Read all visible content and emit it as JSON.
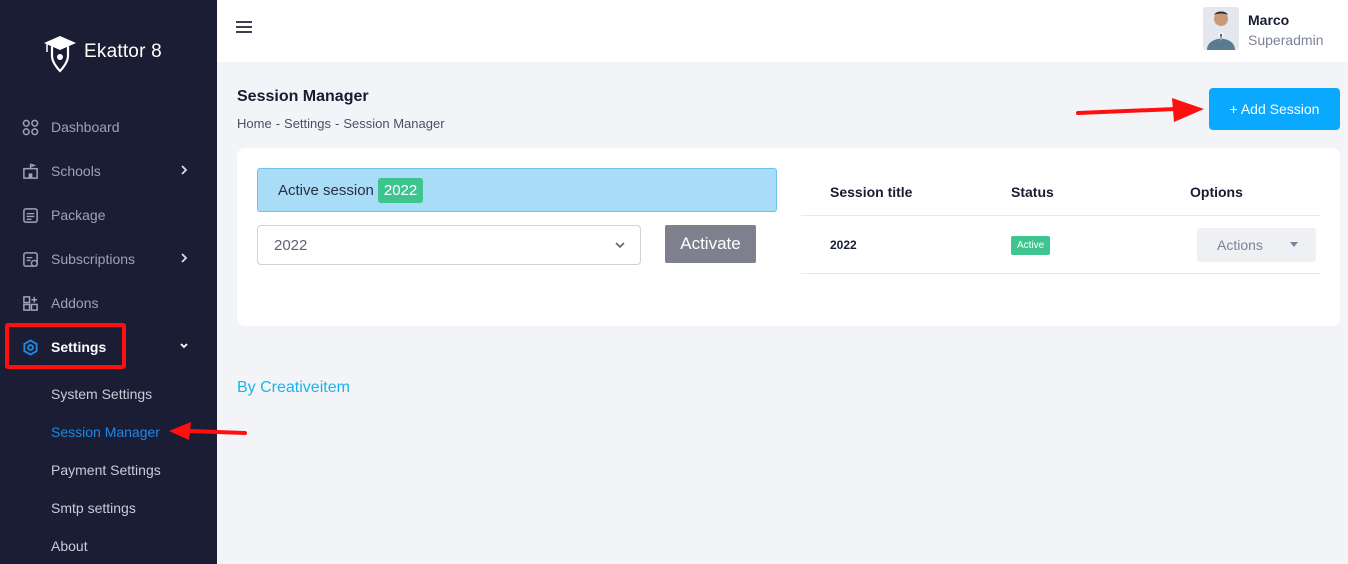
{
  "sidebar": {
    "brand": "Ekattor 8",
    "items": [
      {
        "label": "Dashboard",
        "icon": "dashboard-icon"
      },
      {
        "label": "Schools",
        "icon": "school-icon"
      },
      {
        "label": "Package",
        "icon": "package-icon"
      },
      {
        "label": "Subscriptions",
        "icon": "subscriptions-icon"
      },
      {
        "label": "Addons",
        "icon": "addons-icon"
      },
      {
        "label": "Settings",
        "icon": "settings-gear-icon"
      }
    ],
    "settings_submenu": [
      {
        "label": "System Settings"
      },
      {
        "label": "Session Manager"
      },
      {
        "label": "Payment Settings"
      },
      {
        "label": "Smtp settings"
      },
      {
        "label": "About"
      }
    ]
  },
  "header": {
    "user_name": "Marco",
    "user_role": "Superadmin"
  },
  "page": {
    "title": "Session Manager",
    "breadcrumb": [
      "Home",
      "-",
      "Settings",
      "-",
      "Session Manager"
    ],
    "add_button": "+ Add Session"
  },
  "session_panel": {
    "active_label": "Active session",
    "active_value": "2022",
    "selected_session": "2022",
    "activate_button": "Activate"
  },
  "table": {
    "headers": [
      "Session title",
      "Status",
      "Options"
    ],
    "rows": [
      {
        "title": "2022",
        "status": "Active",
        "options": "Actions"
      }
    ]
  },
  "footer": {
    "credit": "By Creativeitem"
  },
  "colors": {
    "sidebar_bg": "#1b1d35",
    "accent": "#0aa8ff",
    "active_green": "#3ec48e",
    "annotation_red": "#ff1010"
  }
}
